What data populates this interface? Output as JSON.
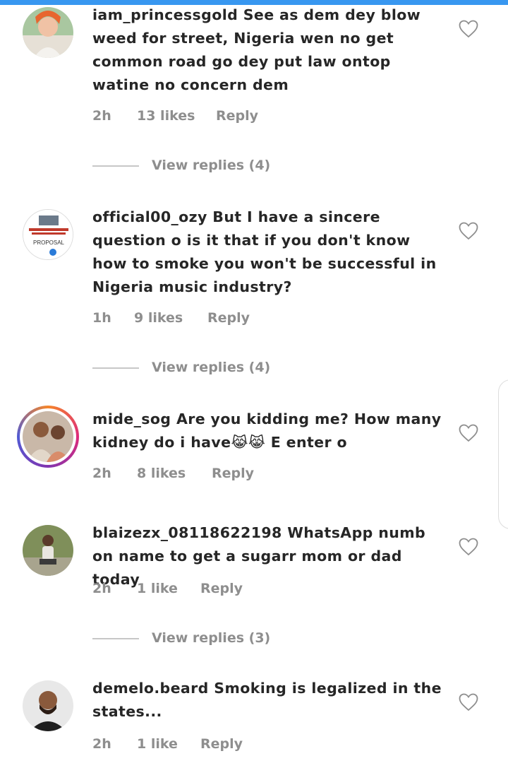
{
  "colors": {
    "accent": "#3897f0",
    "muted": "#8e8e8e",
    "text": "#262626"
  },
  "comments": [
    {
      "username": "iam_princessgold",
      "text": "See as dem dey blow weed for street, Nigeria wen no get common road go dey put law ontop watine no concern dem",
      "time": "2h",
      "likes": "13 likes",
      "reply": "Reply",
      "view_replies": "View replies (4)"
    },
    {
      "username": "official00_ozy",
      "text": "But I have a sincere question o is it that if you don't know how to smoke you won't be successful in Nigeria music industry?",
      "time": "1h",
      "likes": "9 likes",
      "reply": "Reply",
      "view_replies": "View replies (4)",
      "avatar_text": "PROPOSAL"
    },
    {
      "username": "mide_sog",
      "text": "Are you kidding me? How many kidney do i have😹😹 E enter o",
      "time": "2h",
      "likes": "8 likes",
      "reply": "Reply"
    },
    {
      "username": "blaizezx_08118622198",
      "text": "WhatsApp numb on name to get a sugarr mom or dad today",
      "time": "2h",
      "likes": "1 like",
      "reply": "Reply",
      "view_replies": "View replies (3)"
    },
    {
      "username": "demelo.beard",
      "text": "Smoking is legalized in the states...",
      "time": "2h",
      "likes": "1 like",
      "reply": "Reply"
    }
  ],
  "icons": {
    "like": "heart-outline-icon"
  }
}
